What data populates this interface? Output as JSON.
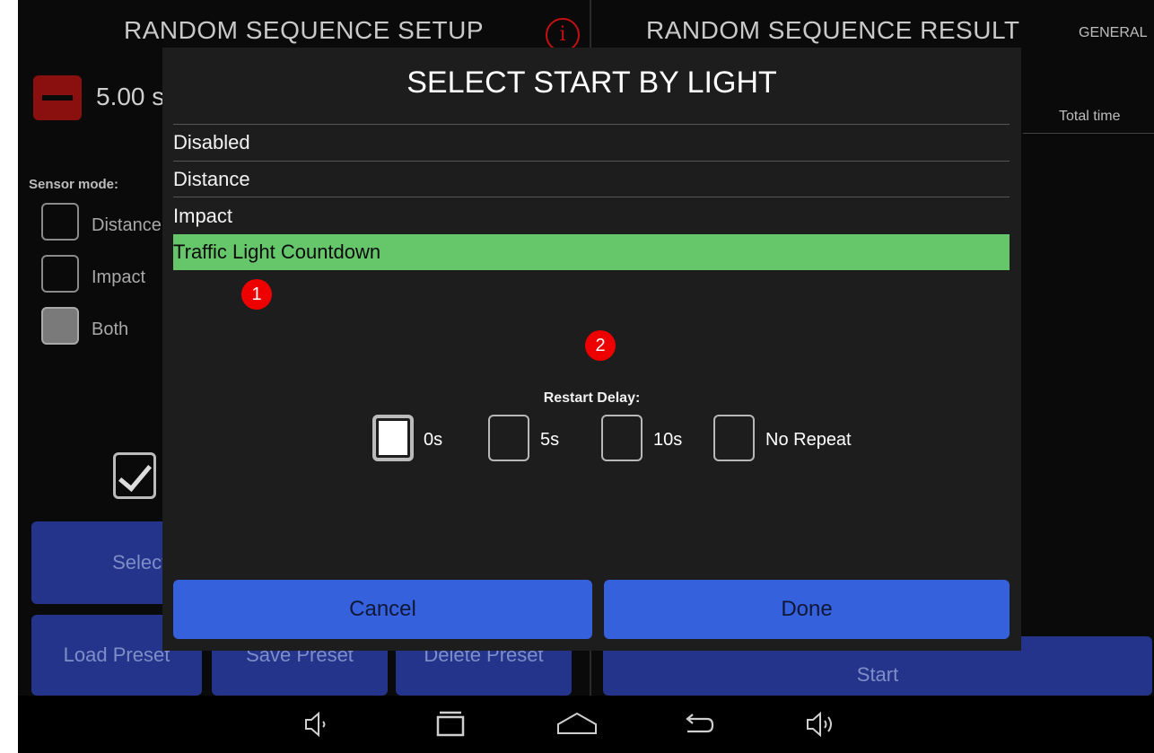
{
  "background": {
    "left_header": "RANDOM SEQUENCE SETUP",
    "right_header": "RANDOM SEQUENCE RESULT",
    "general_tab": "GENERAL",
    "time_value": "5.00 s",
    "total_time_label": "Total time",
    "sensor_mode_label": "Sensor mode:",
    "sensor_options": [
      "Distance",
      "Impact",
      "Both"
    ],
    "select_color_label": "Select Color",
    "load_preset_label": "Load Preset",
    "save_preset_label": "Save Preset",
    "delete_preset_label": "Delete Preset",
    "start_label": "Start"
  },
  "dialog": {
    "title": "SELECT START BY LIGHT",
    "options": [
      "Disabled",
      "Distance",
      "Impact",
      "Traffic Light Countdown"
    ],
    "selected_option": "Traffic Light Countdown",
    "restart_delay_label": "Restart Delay:",
    "delay_options": [
      "0s",
      "5s",
      "10s",
      "No Repeat"
    ],
    "selected_delay": "0s",
    "cancel_label": "Cancel",
    "done_label": "Done"
  },
  "markers": [
    "1",
    "2"
  ],
  "colors": {
    "selected_row": "#66c76a",
    "button_blue": "#3561dc",
    "marker_red": "#e00000"
  }
}
